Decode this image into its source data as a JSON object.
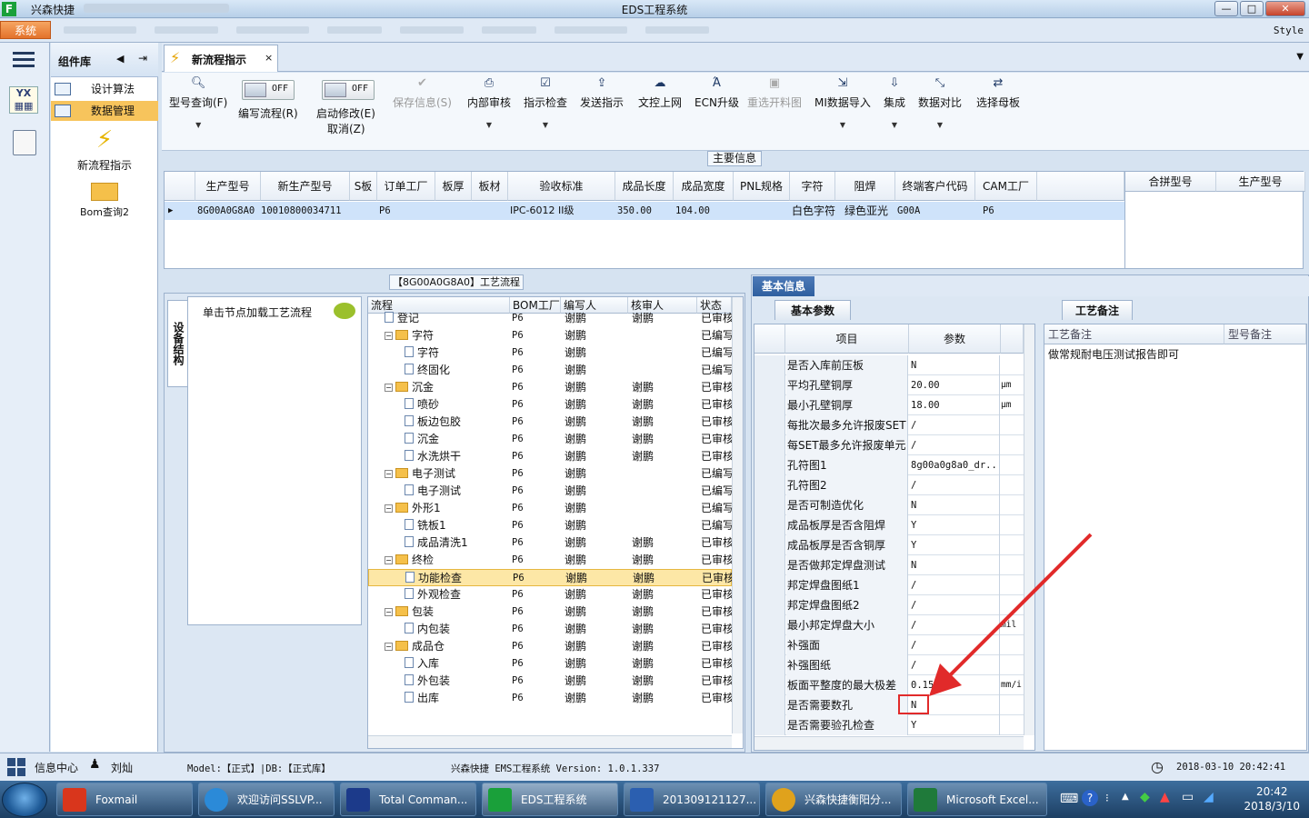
{
  "window": {
    "app_name": "兴森快捷",
    "title": "EDS工程系统",
    "min": "—",
    "max": "□",
    "close": "✕"
  },
  "menu": {
    "system": "系统",
    "style": "Style"
  },
  "sidebar": {
    "title": "组件库",
    "items": [
      {
        "label": "设计算法"
      },
      {
        "label": "数据管理"
      }
    ],
    "big_items": [
      {
        "label": "新流程指示"
      },
      {
        "label": "Bom查询2"
      }
    ]
  },
  "tab": {
    "label": "新流程指示",
    "close": "×"
  },
  "toolbar": {
    "model_query": "型号查询(F)",
    "toggle1": {
      "state": "OFF",
      "label": "编写流程(R)"
    },
    "toggle2": {
      "state": "OFF",
      "label": "启动修改(E)",
      "label2": "取消(Z)"
    },
    "save": "保存信息(S)",
    "internal_review": "内部审核",
    "check": "指示检查",
    "send": "发送指示",
    "upload": "文控上网",
    "ecn": "ECN升级",
    "reselect": "重选开料图",
    "mi_import": "MI数据导入",
    "integrate": "集成",
    "compare": "数据对比",
    "mother": "选择母板"
  },
  "main_info": {
    "label": "主要信息",
    "columns": [
      "生产型号",
      "新生产型号",
      "S板",
      "订单工厂",
      "板厚",
      "板材",
      "验收标准",
      "成品长度",
      "成品宽度",
      "PNL规格",
      "字符",
      "阻焊",
      "终端客户代码",
      "CAM工厂"
    ],
    "row": [
      "8G00A0G8A0",
      "10010800034711",
      "",
      "P6",
      "",
      "",
      "IPC-6012 II级",
      "350.00",
      "104.00",
      "",
      "白色字符",
      "绿色亚光",
      "G00A",
      "P6"
    ],
    "right_columns": [
      "合拼型号",
      "生产型号"
    ]
  },
  "process": {
    "label": "【8G00A0G8A0】工艺流程",
    "vtab": "设备结构",
    "node_hint": "单击节点加载工艺流程",
    "columns": [
      "流程",
      "BOM工厂",
      "编写人",
      "核审人",
      "状态"
    ],
    "rows": [
      {
        "indent": 0,
        "kind": "doc",
        "name": "登记",
        "factory": "P6",
        "writer": "谢鹏",
        "reviewer": "谢鹏",
        "status": "已审核"
      },
      {
        "indent": 0,
        "kind": "folder",
        "name": "字符",
        "factory": "P6",
        "writer": "谢鹏",
        "reviewer": "",
        "status": "已编写"
      },
      {
        "indent": 1,
        "kind": "doc",
        "name": "字符",
        "factory": "P6",
        "writer": "谢鹏",
        "reviewer": "",
        "status": "已编写"
      },
      {
        "indent": 1,
        "kind": "doc",
        "name": "终固化",
        "factory": "P6",
        "writer": "谢鹏",
        "reviewer": "",
        "status": "已编写"
      },
      {
        "indent": 0,
        "kind": "folder",
        "name": "沉金",
        "factory": "P6",
        "writer": "谢鹏",
        "reviewer": "谢鹏",
        "status": "已审核"
      },
      {
        "indent": 1,
        "kind": "doc",
        "name": "喷砂",
        "factory": "P6",
        "writer": "谢鹏",
        "reviewer": "谢鹏",
        "status": "已审核"
      },
      {
        "indent": 1,
        "kind": "doc",
        "name": "板边包胶",
        "factory": "P6",
        "writer": "谢鹏",
        "reviewer": "谢鹏",
        "status": "已审核"
      },
      {
        "indent": 1,
        "kind": "doc",
        "name": "沉金",
        "factory": "P6",
        "writer": "谢鹏",
        "reviewer": "谢鹏",
        "status": "已审核"
      },
      {
        "indent": 1,
        "kind": "doc",
        "name": "水洗烘干",
        "factory": "P6",
        "writer": "谢鹏",
        "reviewer": "谢鹏",
        "status": "已审核"
      },
      {
        "indent": 0,
        "kind": "folder",
        "name": "电子测试",
        "factory": "P6",
        "writer": "谢鹏",
        "reviewer": "",
        "status": "已编写"
      },
      {
        "indent": 1,
        "kind": "doc",
        "name": "电子测试",
        "factory": "P6",
        "writer": "谢鹏",
        "reviewer": "",
        "status": "已编写"
      },
      {
        "indent": 0,
        "kind": "folder",
        "name": "外形1",
        "factory": "P6",
        "writer": "谢鹏",
        "reviewer": "",
        "status": "已编写"
      },
      {
        "indent": 1,
        "kind": "doc",
        "name": "铣板1",
        "factory": "P6",
        "writer": "谢鹏",
        "reviewer": "",
        "status": "已编写"
      },
      {
        "indent": 1,
        "kind": "doc",
        "name": "成品清洗1",
        "factory": "P6",
        "writer": "谢鹏",
        "reviewer": "谢鹏",
        "status": "已审核"
      },
      {
        "indent": 0,
        "kind": "folder",
        "name": "终检",
        "factory": "P6",
        "writer": "谢鹏",
        "reviewer": "谢鹏",
        "status": "已审核"
      },
      {
        "indent": 1,
        "kind": "doc",
        "name": "功能检查",
        "factory": "P6",
        "writer": "谢鹏",
        "reviewer": "谢鹏",
        "status": "已审核",
        "selected": true
      },
      {
        "indent": 1,
        "kind": "doc",
        "name": "外观检查",
        "factory": "P6",
        "writer": "谢鹏",
        "reviewer": "谢鹏",
        "status": "已审核"
      },
      {
        "indent": 0,
        "kind": "folder",
        "name": "包装",
        "factory": "P6",
        "writer": "谢鹏",
        "reviewer": "谢鹏",
        "status": "已审核"
      },
      {
        "indent": 1,
        "kind": "doc",
        "name": "内包装",
        "factory": "P6",
        "writer": "谢鹏",
        "reviewer": "谢鹏",
        "status": "已审核"
      },
      {
        "indent": 0,
        "kind": "folder",
        "name": "成品仓",
        "factory": "P6",
        "writer": "谢鹏",
        "reviewer": "谢鹏",
        "status": "已审核"
      },
      {
        "indent": 1,
        "kind": "doc",
        "name": "入库",
        "factory": "P6",
        "writer": "谢鹏",
        "reviewer": "谢鹏",
        "status": "已审核"
      },
      {
        "indent": 1,
        "kind": "doc",
        "name": "外包装",
        "factory": "P6",
        "writer": "谢鹏",
        "reviewer": "谢鹏",
        "status": "已审核"
      },
      {
        "indent": 1,
        "kind": "doc",
        "name": "出库",
        "factory": "P6",
        "writer": "谢鹏",
        "reviewer": "谢鹏",
        "status": "已审核"
      }
    ]
  },
  "basic_info": {
    "label": "基本信息",
    "params_tab": "基本参数",
    "memo_tab": "工艺备注",
    "columns": [
      "项目",
      "参数"
    ],
    "rows": [
      {
        "k": "是否入库前压板",
        "v": "N",
        "u": ""
      },
      {
        "k": "平均孔壁铜厚",
        "v": "20.00",
        "u": "μm"
      },
      {
        "k": "最小孔壁铜厚",
        "v": "18.00",
        "u": "μm"
      },
      {
        "k": "每批次最多允许报废SET",
        "v": "/",
        "u": ""
      },
      {
        "k": "每SET最多允许报废单元",
        "v": "/",
        "u": ""
      },
      {
        "k": "孔符图1",
        "v": "8g00a0g8a0_dr...",
        "u": ""
      },
      {
        "k": "孔符图2",
        "v": "/",
        "u": ""
      },
      {
        "k": "是否可制造优化",
        "v": "N",
        "u": ""
      },
      {
        "k": "成品板厚是否含阻焊",
        "v": "Y",
        "u": ""
      },
      {
        "k": "成品板厚是否含铜厚",
        "v": "Y",
        "u": ""
      },
      {
        "k": "是否做邦定焊盘测试",
        "v": "N",
        "u": ""
      },
      {
        "k": "邦定焊盘图纸1",
        "v": "/",
        "u": ""
      },
      {
        "k": "邦定焊盘图纸2",
        "v": "/",
        "u": ""
      },
      {
        "k": "最小邦定焊盘大小",
        "v": "/",
        "u": "mil"
      },
      {
        "k": "补强面",
        "v": "/",
        "u": ""
      },
      {
        "k": "补强图纸",
        "v": "/",
        "u": ""
      },
      {
        "k": "板面平整度的最大极差",
        "v": "0.15",
        "u": "mm/i"
      },
      {
        "k": "是否需要数孔",
        "v": "N",
        "u": ""
      },
      {
        "k": "是否需要验孔检查",
        "v": "Y",
        "u": ""
      }
    ],
    "memo_columns": [
      "工艺备注",
      "型号备注"
    ],
    "memo_text": "做常规耐电压测试报告即可"
  },
  "status": {
    "info_center": "信息中心",
    "user": "刘灿",
    "model": "Model:【正式】|DB:【正式库】",
    "version": "兴森快捷 EMS工程系统 Version: 1.0.1.337",
    "datetime": "2018-03-10 20:42:41"
  },
  "taskbar": {
    "items": [
      "Foxmail",
      "欢迎访问SSLVP...",
      "Total Comman...",
      "EDS工程系统",
      "201309121127...",
      "兴森快捷衡阳分...",
      "Microsoft Excel..."
    ],
    "time": "20:42",
    "date": "2018/3/10"
  },
  "colors": {
    "accent": "#2f5f9f",
    "system_menu": "#e3722b",
    "highlight": "#e12a2a",
    "selected_row": "#fde7a6"
  }
}
